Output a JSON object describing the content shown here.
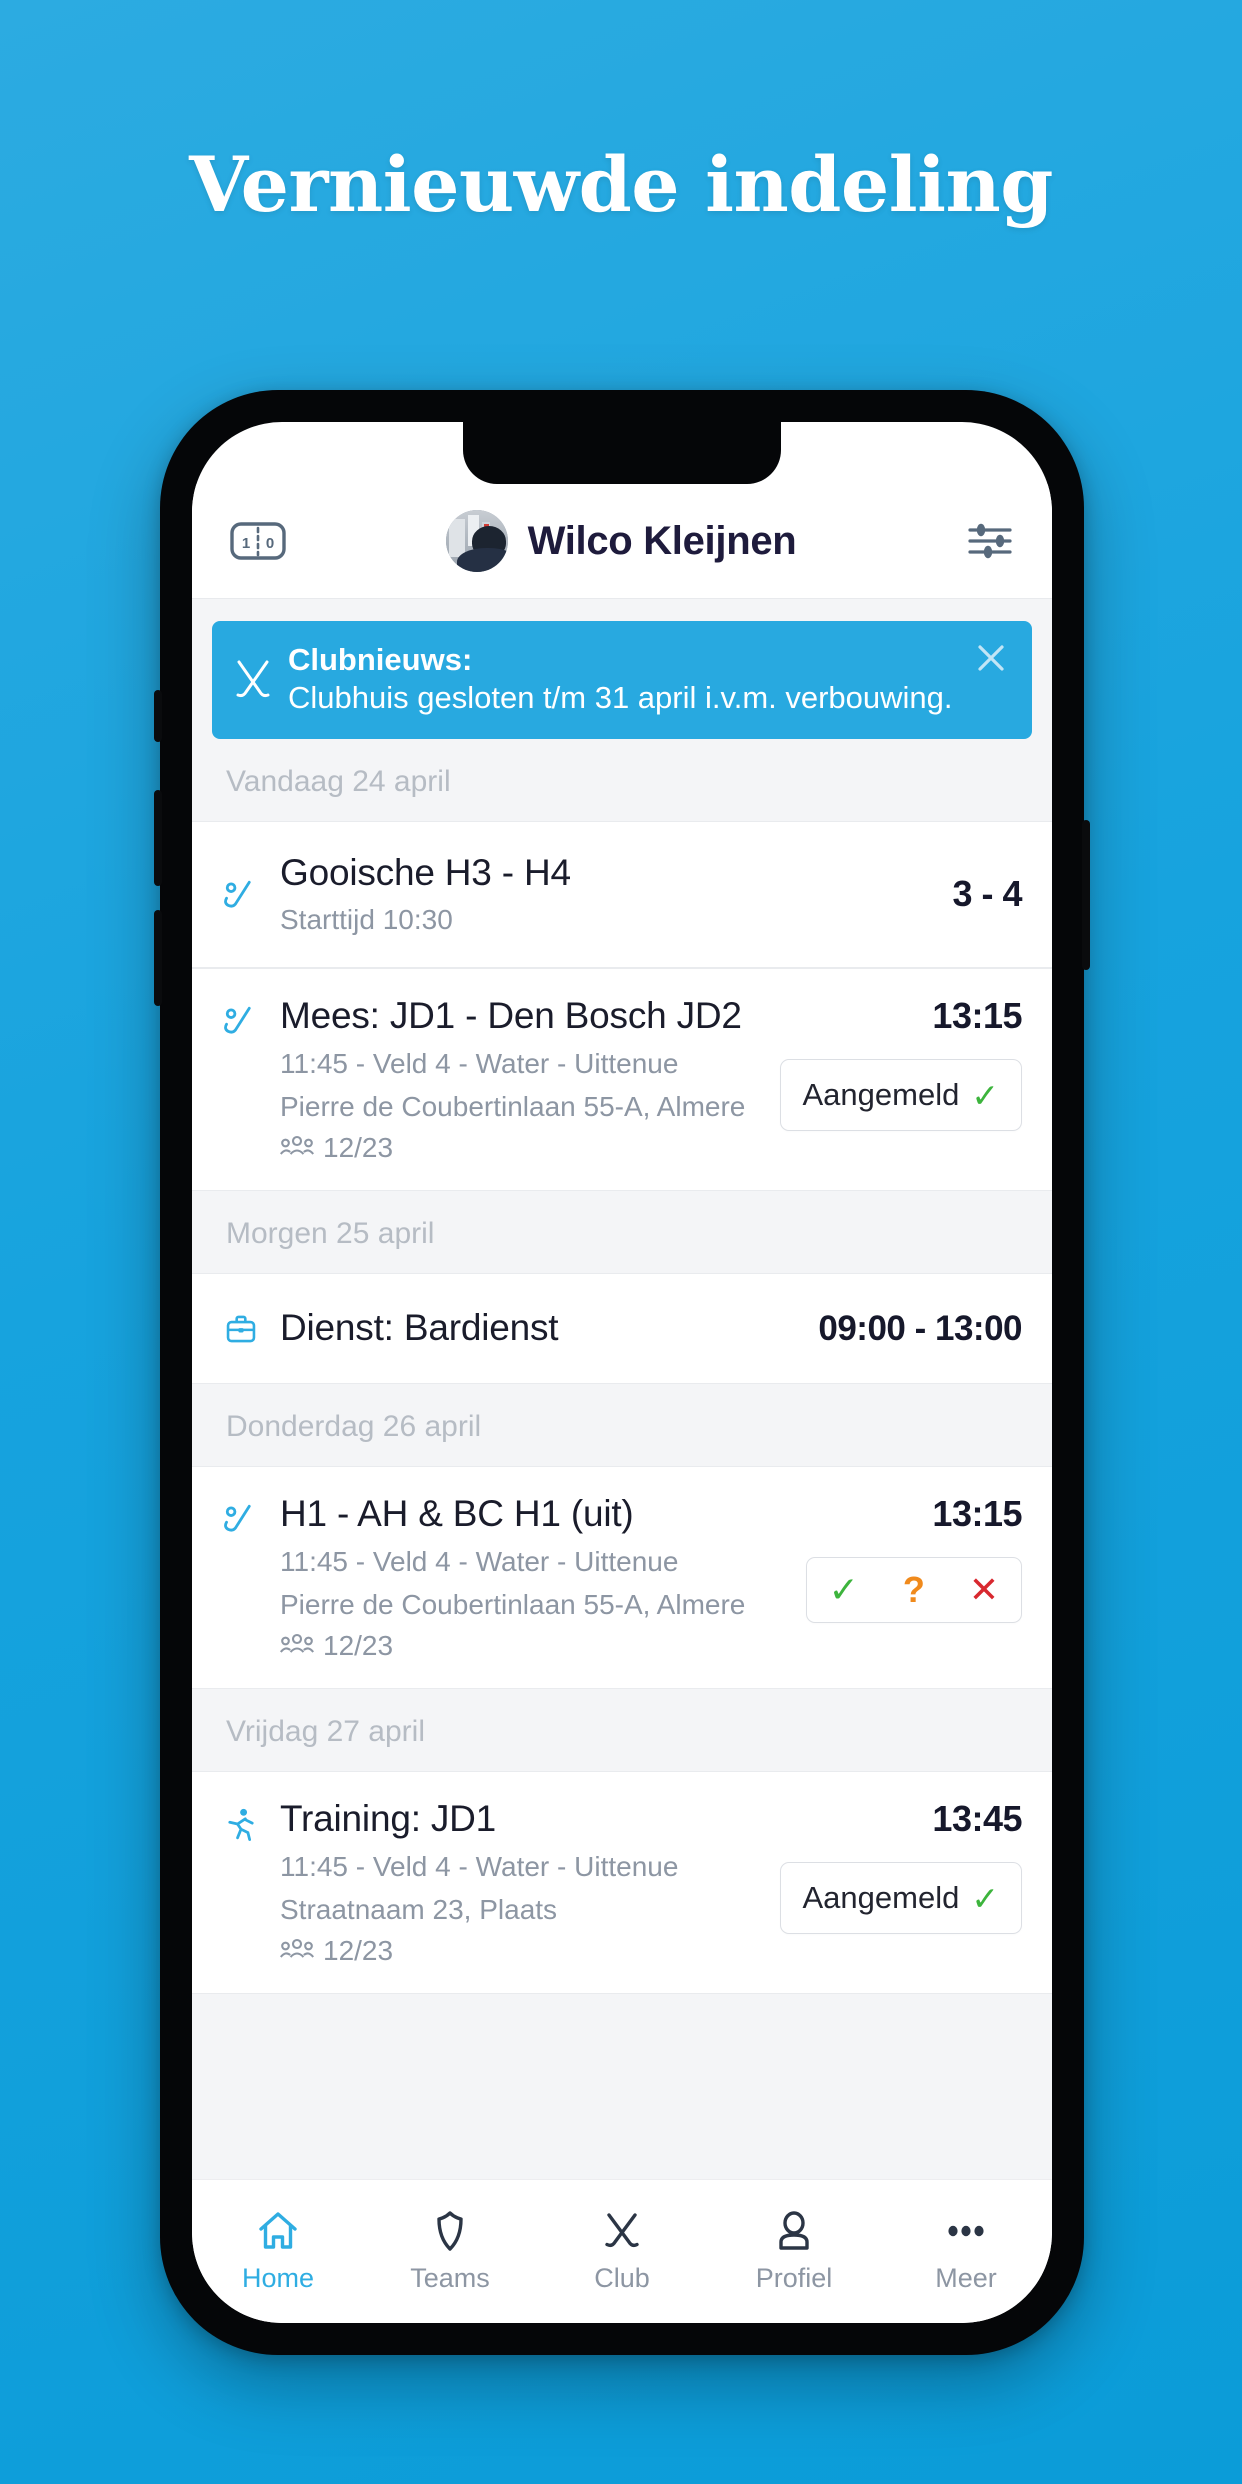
{
  "headline": "Vernieuwde indeling",
  "theme": {
    "background_blue": "#17a3de",
    "accent_blue": "#28a9e0",
    "text_dark": "#1e1b3c",
    "muted": "#8d96a3",
    "green": "#3db43d",
    "orange": "#f08a1c",
    "red": "#d8282f"
  },
  "header": {
    "score_icon": "scoreboard-icon",
    "score_home": "1",
    "score_away": "0",
    "avatar": "user-avatar",
    "user_name": "Wilco Kleijnen",
    "settings_icon": "sliders-icon"
  },
  "banner": {
    "icon": "crossed-hockey-sticks-icon",
    "title": "Clubnieuws:",
    "message": "Clubhuis gesloten t/m 31 april i.v.m. verbouwing.",
    "close_icon": "close-icon"
  },
  "agenda": [
    {
      "day_label": "Vandaag 24 april",
      "events": [
        {
          "icon": "hockey-stick-ball-icon",
          "title": "Gooische H3 - H4",
          "lines": [
            "Starttijd 10:30"
          ],
          "attendance": null,
          "right_value": "3 - 4",
          "action": null
        },
        {
          "icon": "hockey-stick-ball-icon",
          "title": "Mees: JD1 - Den Bosch JD2",
          "lines": [
            "11:45 - Veld 4 - Water - Uittenue",
            "Pierre de Coubertinlaan 55-A, Almere"
          ],
          "attendance": "12/23",
          "right_value": "13:15",
          "action": {
            "type": "status",
            "label": "Aangemeld",
            "icon": "check-icon"
          }
        }
      ]
    },
    {
      "day_label": "Morgen 25 april",
      "events": [
        {
          "icon": "briefcase-icon",
          "title": "Dienst: Bardienst",
          "lines": [],
          "attendance": null,
          "right_value": "09:00 - 13:00",
          "action": null
        }
      ]
    },
    {
      "day_label": "Donderdag 26 april",
      "events": [
        {
          "icon": "hockey-stick-ball-icon",
          "title": "H1 - AH & BC H1 (uit)",
          "lines": [
            "11:45 - Veld 4 - Water - Uittenue",
            "Pierre de Coubertinlaan 55-A, Almere"
          ],
          "attendance": "12/23",
          "right_value": "13:15",
          "action": {
            "type": "choice",
            "yes_icon": "check-icon",
            "maybe_icon": "question-mark-icon",
            "no_icon": "cross-icon",
            "yes_label": "✓",
            "maybe_label": "?",
            "no_label": "✕"
          }
        }
      ]
    },
    {
      "day_label": "Vrijdag 27 april",
      "events": [
        {
          "icon": "running-person-icon",
          "title": "Training: JD1",
          "lines": [
            "11:45 - Veld 4 - Water - Uittenue",
            "Straatnaam 23, Plaats"
          ],
          "attendance": "12/23",
          "right_value": "13:45",
          "action": {
            "type": "status",
            "label": "Aangemeld",
            "icon": "check-icon"
          }
        }
      ]
    }
  ],
  "tabbar": [
    {
      "label": "Home",
      "icon": "home-icon",
      "active": true
    },
    {
      "label": "Teams",
      "icon": "shield-icon",
      "active": false
    },
    {
      "label": "Club",
      "icon": "crossed-sticks-icon",
      "active": false
    },
    {
      "label": "Profiel",
      "icon": "person-icon",
      "active": false
    },
    {
      "label": "Meer",
      "icon": "ellipsis-icon",
      "active": false
    }
  ]
}
